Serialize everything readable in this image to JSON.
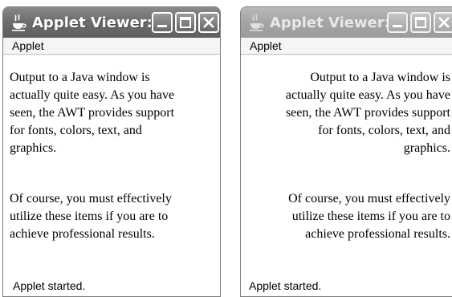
{
  "windows": [
    {
      "title": "Applet Viewer:...",
      "menu_label": "Applet",
      "paragraphs": [
        "Output to a Java window is\nactually quite easy. As you have\nseen, the AWT provides support\nfor fonts, colors, text, and\ngraphics.",
        "Of course, you must effectively\nutilize these items if you are to\nachieve professional results."
      ],
      "status": "Applet started.",
      "alignment": "left",
      "focused": true
    },
    {
      "title": "Applet Viewer:...",
      "menu_label": "Applet",
      "paragraphs": [
        "Output to a Java window is\nactually quite easy. As you have\nseen, the AWT provides support\nfor fonts, colors, text, and\ngraphics.",
        "Of course, you must effectively\nutilize these items if you are to\nachieve professional results."
      ],
      "status": "Applet started.",
      "alignment": "right",
      "focused": false
    }
  ],
  "icons": {
    "app_icon": "java-cup-icon",
    "minimize": "minimize-icon",
    "maximize": "maximize-icon",
    "close": "close-icon"
  }
}
